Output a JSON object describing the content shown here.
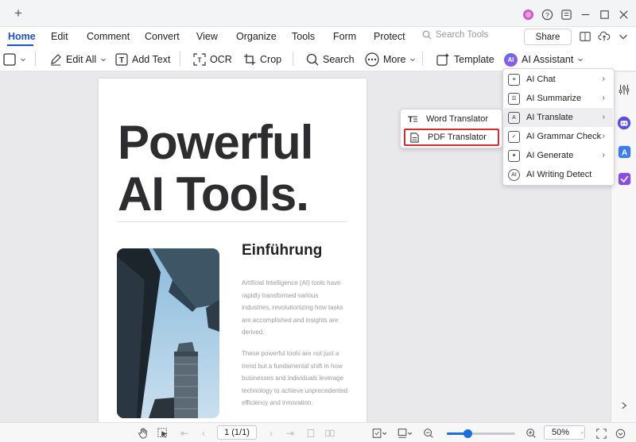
{
  "menubar": {
    "items": [
      "Home",
      "Edit",
      "Comment",
      "Convert",
      "View",
      "Organize",
      "Tools",
      "Form",
      "Protect"
    ],
    "search_placeholder": "Search Tools",
    "share_label": "Share"
  },
  "toolbar": {
    "edit_all": "Edit All",
    "add_text": "Add Text",
    "ocr": "OCR",
    "crop": "Crop",
    "search": "Search",
    "more": "More",
    "template": "Template",
    "ai_assistant": "AI Assistant",
    "ai_badge": "AI"
  },
  "ai_menu": {
    "items": [
      {
        "label": "AI Chat",
        "icon": "chat-icon"
      },
      {
        "label": "AI Summarize",
        "icon": "summarize-icon"
      },
      {
        "label": "AI Translate",
        "icon": "translate-icon"
      },
      {
        "label": "AI Grammar Check",
        "icon": "grammar-check-icon"
      },
      {
        "label": "AI Generate",
        "icon": "generate-icon"
      },
      {
        "label": "AI Writing Detect",
        "icon": "writing-detect-icon"
      }
    ],
    "hovered": "AI Translate",
    "detect_badge": "AI"
  },
  "translate_menu": {
    "items": [
      "Word Translator",
      "PDF Translator"
    ],
    "highlighted": "PDF Translator"
  },
  "document": {
    "title_line1": "Powerful",
    "title_line2": "AI Tools.",
    "section_heading": "Einführung",
    "para1": "Artificial Intelligence (AI) tools have rapidly transformed various industries, revolutionizing how tasks are accomplished and insights are derived.",
    "para2": "These powerful tools are not just a trend but a fundamental shift in how businesses and individuals leverage technology to achieve unprecedented efficiency and innovation."
  },
  "statusbar": {
    "page_indicator": "1 (1/1)",
    "zoom_level": "50%",
    "zoom_fraction": 0.3
  },
  "colors": {
    "accent": "#1a4fd6",
    "highlight_border": "#d62c2c",
    "slider": "#1a6fe0"
  }
}
